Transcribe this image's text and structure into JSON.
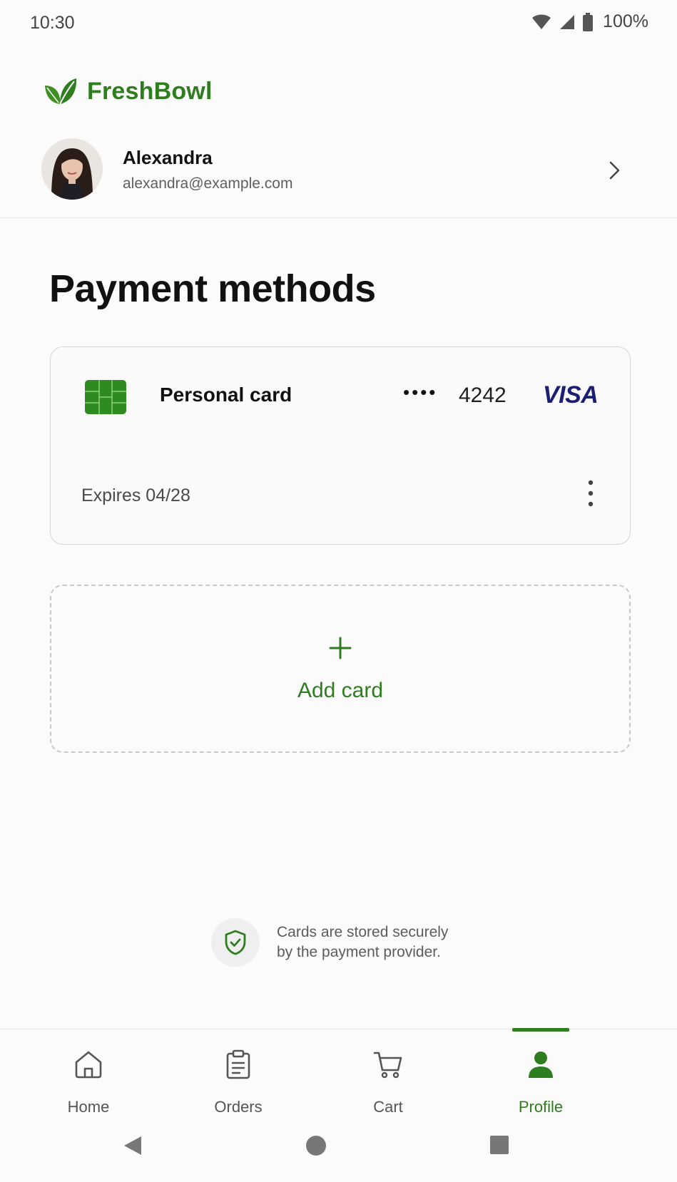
{
  "status_bar": {
    "time": "10:30",
    "battery": "100%"
  },
  "brand": {
    "name": "FreshBowl",
    "icon": "leaf-icon",
    "color": "#2e7d1e"
  },
  "profile": {
    "name": "Alexandra",
    "email": "alexandra@example.com"
  },
  "page": {
    "title": "Payment methods"
  },
  "card": {
    "label": "Personal card",
    "masked": "••••",
    "last4": "4242",
    "brand": "VISA",
    "expiry": "Expires 04/28"
  },
  "add_card": {
    "label": "Add card"
  },
  "secure_note": {
    "line1": "Cards are stored securely",
    "line2": "by the payment provider."
  },
  "bottom_nav": {
    "items": [
      {
        "label": "Home",
        "icon": "home-icon"
      },
      {
        "label": "Orders",
        "icon": "clipboard-icon"
      },
      {
        "label": "Cart",
        "icon": "cart-icon"
      },
      {
        "label": "Profile",
        "icon": "person-icon",
        "active": true
      }
    ]
  },
  "colors": {
    "accent": "#2e7d1e",
    "visa": "#1a1f71"
  }
}
